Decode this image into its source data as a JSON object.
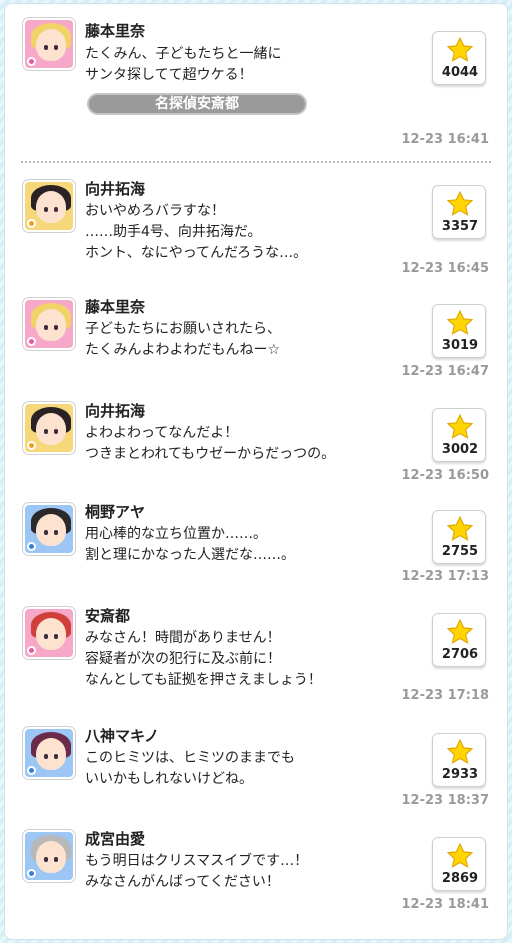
{
  "posts": [
    {
      "name": "藤本里奈",
      "message": "たくみん、子どもたちと一緒に\nサンタ探してて超ウケる！",
      "likes": "4044",
      "time": "12-23 16:41",
      "tag": "名探偵安斎都",
      "avatar": {
        "bg": "#f7a8c8",
        "hair": "#f1d36a",
        "type": "#ea5a9a"
      }
    },
    {
      "name": "向井拓海",
      "message": "おいやめろバラすな！\n……助手4号、向井拓海だ。\nホント、なにやってんだろうな…。",
      "likes": "3357",
      "time": "12-23 16:45",
      "avatar": {
        "bg": "#f6d77a",
        "hair": "#2b2226",
        "type": "#f0a020"
      }
    },
    {
      "name": "藤本里奈",
      "message": "子どもたちにお願いされたら、\nたくみんよわよわだもんねー☆",
      "likes": "3019",
      "time": "12-23 16:47",
      "avatar": {
        "bg": "#f7a8c8",
        "hair": "#f1d36a",
        "type": "#ea5a9a"
      }
    },
    {
      "name": "向井拓海",
      "message": "よわよわってなんだよ！\nつきまとわれてもウゼーからだっつの。",
      "likes": "3002",
      "time": "12-23 16:50",
      "avatar": {
        "bg": "#f6d77a",
        "hair": "#2b2226",
        "type": "#f0a020"
      }
    },
    {
      "name": "桐野アヤ",
      "message": "用心棒的な立ち位置か……。\n割と理にかなった人選だな……。",
      "likes": "2755",
      "time": "12-23 17:13",
      "avatar": {
        "bg": "#9cc6f3",
        "hair": "#2a2a2a",
        "type": "#3a7fe0"
      }
    },
    {
      "name": "安斎都",
      "message": "みなさん！時間がありません！\n容疑者が次の犯行に及ぶ前に！\nなんとしても証拠を押さえましょう！",
      "likes": "2706",
      "time": "12-23 17:18",
      "avatar": {
        "bg": "#f7a8c8",
        "hair": "#d0403a",
        "type": "#ea5a9a"
      }
    },
    {
      "name": "八神マキノ",
      "message": "このヒミツは、ヒミツのままでも\nいいかもしれないけどね。",
      "likes": "2933",
      "time": "12-23 18:37",
      "avatar": {
        "bg": "#9cc6f3",
        "hair": "#6a2a4a",
        "type": "#3a7fe0"
      }
    },
    {
      "name": "成宮由愛",
      "message": "もう明日はクリスマスイブです…！\nみなさんがんばってください！",
      "likes": "2869",
      "time": "12-23 18:41",
      "avatar": {
        "bg": "#9cc6f3",
        "hair": "#b8b8b8",
        "type": "#3a7fe0"
      }
    }
  ],
  "icons": {
    "like": "star-icon",
    "type_badge": "type-badge-icon"
  },
  "colors": {
    "star": "#ffd400",
    "star_outline": "#e0a800",
    "timestamp": "#9a9a9a"
  }
}
